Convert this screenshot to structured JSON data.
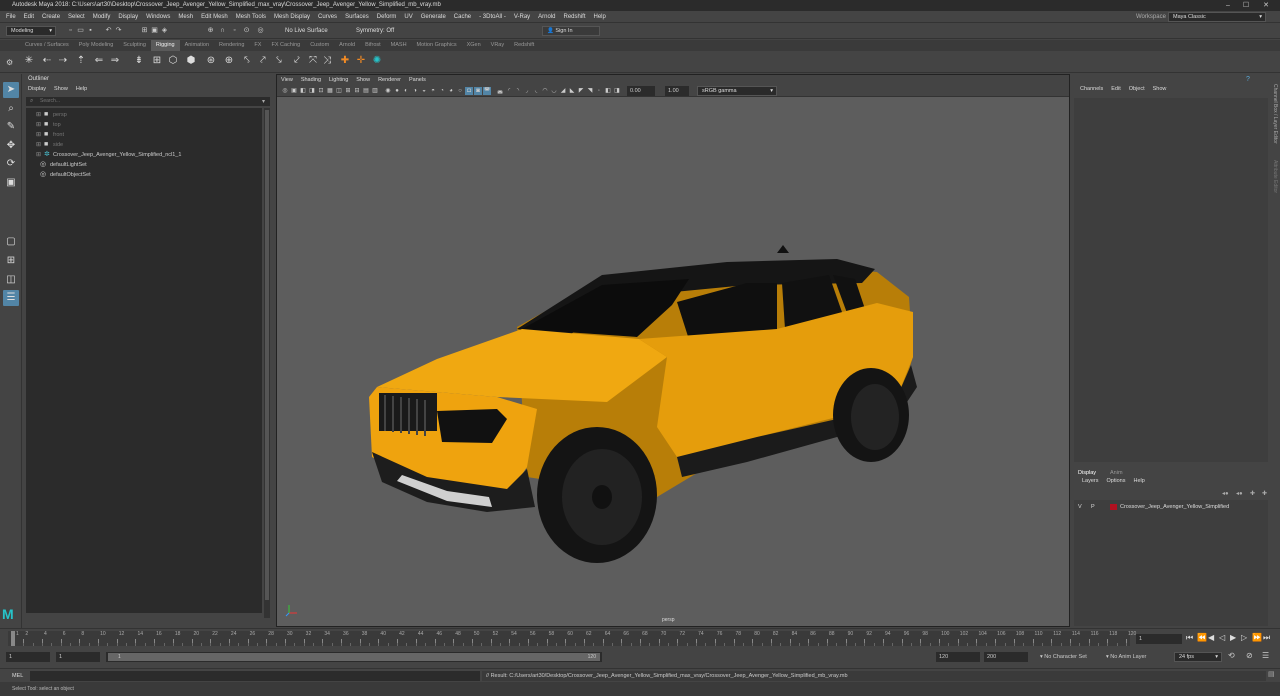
{
  "window": {
    "title": "Autodesk Maya 2018: C:\\Users\\art30\\Desktop\\Crossover_Jeep_Avenger_Yellow_Simplified_max_vray\\Crossover_Jeep_Avenger_Yellow_Simplified_mb_vray.mb",
    "min": "–",
    "max": "☐",
    "close": "✕"
  },
  "menubar": {
    "items": [
      "File",
      "Edit",
      "Create",
      "Select",
      "Modify",
      "Display",
      "Windows",
      "Mesh",
      "Edit Mesh",
      "Mesh Tools",
      "Mesh Display",
      "Curves",
      "Surfaces",
      "Deform",
      "UV",
      "Generate",
      "Cache",
      "- 3DtoAll -",
      "V-Ray",
      "Arnold",
      "Redshift",
      "Help"
    ],
    "workspace_label": "Workspace :",
    "workspace_value": "Maya Classic"
  },
  "statusline": {
    "mode": "Modeling",
    "live_surface": "No Live Surface",
    "symmetry": "Symmetry: Off",
    "sign_in": "Sign In"
  },
  "shelf_tabs": [
    "Curves / Surfaces",
    "Poly Modeling",
    "Sculpting",
    "Rigging",
    "Animation",
    "Rendering",
    "FX",
    "FX Caching",
    "Custom",
    "Arnold",
    "Bifrost",
    "MASH",
    "Motion Graphics",
    "XGen",
    "VRay",
    "Redshift"
  ],
  "shelf_active": "Rigging",
  "outliner": {
    "title": "Outliner",
    "menu": [
      "Display",
      "Show",
      "Help"
    ],
    "search_placeholder": "Search...",
    "items": [
      {
        "label": "persp",
        "dim": true,
        "icon": "camera-icon"
      },
      {
        "label": "top",
        "dim": true,
        "icon": "camera-icon"
      },
      {
        "label": "front",
        "dim": true,
        "icon": "camera-icon"
      },
      {
        "label": "side",
        "dim": true,
        "icon": "camera-icon"
      },
      {
        "label": "Crossover_Jeep_Avenger_Yellow_Simplified_ncl1_1",
        "dim": false,
        "icon": "group-icon"
      },
      {
        "label": "defaultLightSet",
        "dim": false,
        "icon": "set-icon"
      },
      {
        "label": "defaultObjectSet",
        "dim": false,
        "icon": "set-icon"
      }
    ]
  },
  "viewport": {
    "menu": [
      "View",
      "Shading",
      "Lighting",
      "Show",
      "Renderer",
      "Panels"
    ],
    "exposure": "0.00",
    "gamma": "1.00",
    "colorspace": "sRGB gamma",
    "camera_label": "persp"
  },
  "channel_box": {
    "menu": [
      "Channels",
      "Edit",
      "Object",
      "Show"
    ],
    "side_tabs": [
      "Channel Box / Layer Editor",
      "Attribute Editor"
    ]
  },
  "layer_editor": {
    "tabs": [
      "Display",
      "Anim"
    ],
    "menu": [
      "Layers",
      "Options",
      "Help"
    ],
    "layer": {
      "v": "V",
      "p": "P",
      "name": "Crossover_Jeep_Avenger_Yellow_Simplified",
      "color": "#b01020"
    }
  },
  "timeline": {
    "ticks": [
      "1",
      "2",
      "4",
      "6",
      "8",
      "10",
      "12",
      "14",
      "16",
      "18",
      "20",
      "22",
      "24",
      "26",
      "28",
      "30",
      "32",
      "34",
      "36",
      "38",
      "40",
      "42",
      "44",
      "46",
      "48",
      "50",
      "52",
      "54",
      "56",
      "58",
      "60",
      "62",
      "64",
      "66",
      "68",
      "70",
      "72",
      "74",
      "76",
      "78",
      "80",
      "82",
      "84",
      "86",
      "88",
      "90",
      "92",
      "94",
      "96",
      "98",
      "100",
      "102",
      "104",
      "106",
      "108",
      "110",
      "112",
      "114",
      "116",
      "118",
      "120"
    ],
    "current_frame": "1"
  },
  "range": {
    "start": "1",
    "inner_start": "1",
    "slider_start": "1",
    "slider_end": "120",
    "inner_end": "120",
    "end": "200",
    "character_set": "No Character Set",
    "anim_layer": "No Anim Layer",
    "fps": "24 fps"
  },
  "cmdline": {
    "label": "MEL",
    "result": "// Result: C:/Users/art30/Desktop/Crossover_Jeep_Avenger_Yellow_Simplified_max_vray/Crossover_Jeep_Avenger_Yellow_Simplified_mb_vray.mb"
  },
  "helpline": "Select Tool: select an object",
  "colors": {
    "accent": "#5285a6",
    "car_body": "#e8a20c",
    "car_dark": "#1a1a1a"
  }
}
